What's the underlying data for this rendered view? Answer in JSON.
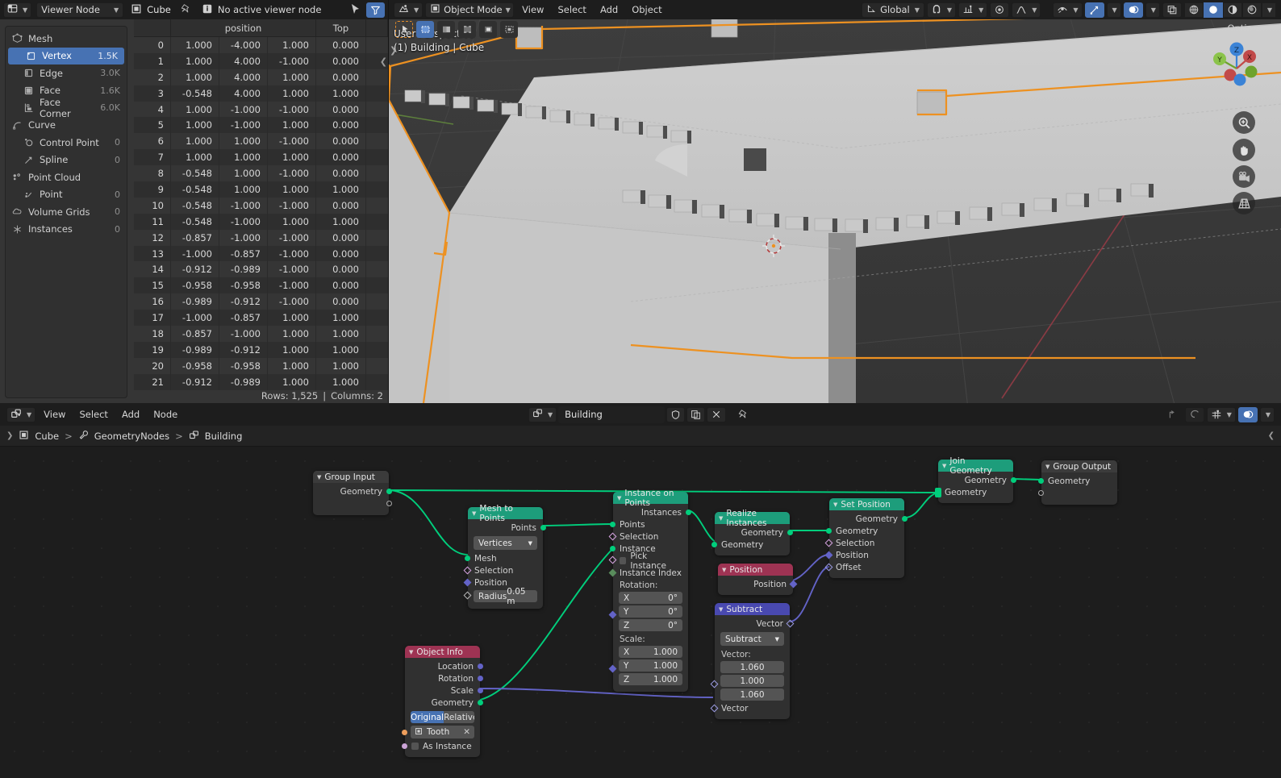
{
  "spreadsheet": {
    "editor_type_icon": "spreadsheet-editor-icon",
    "viewer_mode": "Viewer Node",
    "object_name": "Cube",
    "pin_icon": "pin-icon",
    "info_icon": "info-icon",
    "info_text": "No active viewer node",
    "cursor_filter_icon": "cursor-icon",
    "filter_icon": "filter-icon",
    "dataset": [
      {
        "label": "Mesh",
        "icon": "mesh-data-icon",
        "count": "",
        "level": 0,
        "selected": false
      },
      {
        "label": "Vertex",
        "icon": "vertex-icon",
        "count": "1.5K",
        "level": 1,
        "selected": true
      },
      {
        "label": "Edge",
        "icon": "edge-icon",
        "count": "3.0K",
        "level": 1,
        "selected": false
      },
      {
        "label": "Face",
        "icon": "face-icon",
        "count": "1.6K",
        "level": 1,
        "selected": false
      },
      {
        "label": "Face Corner",
        "icon": "face-corner-icon",
        "count": "6.0K",
        "level": 1,
        "selected": false
      },
      {
        "label": "Curve",
        "icon": "curve-data-icon",
        "count": "",
        "level": 0,
        "selected": false
      },
      {
        "label": "Control Point",
        "icon": "control-point-icon",
        "count": "0",
        "level": 1,
        "selected": false
      },
      {
        "label": "Spline",
        "icon": "spline-icon",
        "count": "0",
        "level": 1,
        "selected": false
      },
      {
        "label": "Point Cloud",
        "icon": "point-cloud-icon",
        "count": "",
        "level": 0,
        "selected": false
      },
      {
        "label": "Point",
        "icon": "point-icon",
        "count": "0",
        "level": 1,
        "selected": false
      },
      {
        "label": "Volume Grids",
        "icon": "volume-icon",
        "count": "0",
        "level": 0,
        "selected": false
      },
      {
        "label": "Instances",
        "icon": "instances-icon",
        "count": "0",
        "level": 0,
        "selected": false
      }
    ],
    "columns": {
      "index": "",
      "position": "position",
      "top": "Top"
    },
    "rows": [
      {
        "i": "0",
        "x": "1.000",
        "y": "-4.000",
        "z": "1.000",
        "top": "0.000"
      },
      {
        "i": "1",
        "x": "1.000",
        "y": "4.000",
        "z": "-1.000",
        "top": "0.000"
      },
      {
        "i": "2",
        "x": "1.000",
        "y": "4.000",
        "z": "1.000",
        "top": "0.000"
      },
      {
        "i": "3",
        "x": "-0.548",
        "y": "4.000",
        "z": "1.000",
        "top": "1.000"
      },
      {
        "i": "4",
        "x": "1.000",
        "y": "-1.000",
        "z": "-1.000",
        "top": "0.000"
      },
      {
        "i": "5",
        "x": "1.000",
        "y": "-1.000",
        "z": "1.000",
        "top": "0.000"
      },
      {
        "i": "6",
        "x": "1.000",
        "y": "1.000",
        "z": "-1.000",
        "top": "0.000"
      },
      {
        "i": "7",
        "x": "1.000",
        "y": "1.000",
        "z": "1.000",
        "top": "0.000"
      },
      {
        "i": "8",
        "x": "-0.548",
        "y": "1.000",
        "z": "-1.000",
        "top": "0.000"
      },
      {
        "i": "9",
        "x": "-0.548",
        "y": "1.000",
        "z": "1.000",
        "top": "1.000"
      },
      {
        "i": "10",
        "x": "-0.548",
        "y": "-1.000",
        "z": "-1.000",
        "top": "0.000"
      },
      {
        "i": "11",
        "x": "-0.548",
        "y": "-1.000",
        "z": "1.000",
        "top": "1.000"
      },
      {
        "i": "12",
        "x": "-0.857",
        "y": "-1.000",
        "z": "-1.000",
        "top": "0.000"
      },
      {
        "i": "13",
        "x": "-1.000",
        "y": "-0.857",
        "z": "-1.000",
        "top": "0.000"
      },
      {
        "i": "14",
        "x": "-0.912",
        "y": "-0.989",
        "z": "-1.000",
        "top": "0.000"
      },
      {
        "i": "15",
        "x": "-0.958",
        "y": "-0.958",
        "z": "-1.000",
        "top": "0.000"
      },
      {
        "i": "16",
        "x": "-0.989",
        "y": "-0.912",
        "z": "-1.000",
        "top": "0.000"
      },
      {
        "i": "17",
        "x": "-1.000",
        "y": "-0.857",
        "z": "1.000",
        "top": "1.000"
      },
      {
        "i": "18",
        "x": "-0.857",
        "y": "-1.000",
        "z": "1.000",
        "top": "1.000"
      },
      {
        "i": "19",
        "x": "-0.989",
        "y": "-0.912",
        "z": "1.000",
        "top": "1.000"
      },
      {
        "i": "20",
        "x": "-0.958",
        "y": "-0.958",
        "z": "1.000",
        "top": "1.000"
      },
      {
        "i": "21",
        "x": "-0.912",
        "y": "-0.989",
        "z": "1.000",
        "top": "1.000"
      }
    ],
    "status_rows": "Rows: 1,525",
    "status_sep": "|",
    "status_columns": "Columns: 2"
  },
  "viewport": {
    "editor_icon": "editor-type-icon",
    "mode": "Object Mode",
    "menus": [
      "View",
      "Select",
      "Add",
      "Object"
    ],
    "transform_orientation": "Global",
    "snap_icon": "snap-magnet-icon",
    "proportional_icon": "proportional-editing-icon",
    "tools": [
      "tweak-tool-icon",
      "select-box-icon",
      "select-circle-icon",
      "select-lasso-icon",
      "select-extend-icon",
      "select-subtract-icon"
    ],
    "overlay_icons": [
      "visibility-icon",
      "gizmo-icon",
      "overlays-icon",
      "xray-icon"
    ],
    "shading_modes": [
      "wireframe-shading-icon",
      "solid-shading-icon",
      "material-preview-icon",
      "rendered-shading-icon"
    ],
    "options_label": "Options",
    "perspective_label": "User Perspective",
    "scene_label": "(1) Building | Cube",
    "gizmo_axes": {
      "x": "X",
      "y": "Y",
      "z": "Z"
    },
    "side_buttons": [
      "zoom-icon",
      "pan-hand-icon",
      "camera-view-icon",
      "ortho-persp-icon"
    ],
    "selection_color": "#ed9121",
    "object_color": "#c6c6c6",
    "background_color": "#393939"
  },
  "node_editor": {
    "editor_icon": "geometry-nodes-editor-icon",
    "menus": [
      "View",
      "Select",
      "Add",
      "Node"
    ],
    "modifier_icon": "geometry-nodes-icon",
    "tree_name": "Building",
    "shield_icon": "fake-user-icon",
    "copy_icon": "new-copy-icon",
    "close_icon": "unlink-icon",
    "pin_icon": "pin-icon",
    "snap_up_icon": "parent-up-icon",
    "overlay_icon": "node-overlay-icon",
    "snap_icon": "snap-grid-icon",
    "gizmo_icon": "node-gizmo-icon",
    "breadcrumb": [
      {
        "label": "Cube",
        "icon": "object-icon"
      },
      {
        "label": "GeometryNodes",
        "icon": "modifier-wrench-icon"
      },
      {
        "label": "Building",
        "icon": "geometry-nodes-icon"
      }
    ],
    "breadcrumb_sep": ">",
    "nodes": {
      "group_input": {
        "title": "Group Input",
        "color": "#3b3b3b",
        "outputs": [
          "Geometry",
          ""
        ]
      },
      "mesh_to_points": {
        "title": "Mesh to Points",
        "color": "#1d9d7b",
        "outputs": [
          "Points"
        ],
        "mode": "Vertices",
        "inputs": [
          "Mesh",
          "Selection",
          "Position"
        ],
        "radius_label": "Radius",
        "radius_value": "0.05 m"
      },
      "instance_on_points": {
        "title": "Instance on Points",
        "color": "#1d9d7b",
        "outputs": [
          "Instances"
        ],
        "inputs": [
          "Points",
          "Selection",
          "Instance",
          "Pick Instance",
          "Instance Index"
        ],
        "rotation_label": "Rotation:",
        "rotation": [
          {
            "axis": "X",
            "value": "0°"
          },
          {
            "axis": "Y",
            "value": "0°"
          },
          {
            "axis": "Z",
            "value": "0°"
          }
        ],
        "scale_label": "Scale:",
        "scale": [
          {
            "axis": "X",
            "value": "1.000"
          },
          {
            "axis": "Y",
            "value": "1.000"
          },
          {
            "axis": "Z",
            "value": "1.000"
          }
        ]
      },
      "realize_instances": {
        "title": "Realize Instances",
        "color": "#1d9d7b",
        "outputs": [
          "Geometry"
        ],
        "inputs": [
          "Geometry"
        ]
      },
      "position": {
        "title": "Position",
        "color": "#9e3353",
        "outputs": [
          "Position"
        ]
      },
      "subtract": {
        "title": "Subtract",
        "color": "#4949b0",
        "outputs": [
          "Vector"
        ],
        "operation": "Subtract",
        "vector_label": "Vector:",
        "vector_values": [
          "1.060",
          "1.000",
          "1.060"
        ],
        "input_label": "Vector"
      },
      "set_position": {
        "title": "Set Position",
        "color": "#1d9d7b",
        "outputs": [
          "Geometry"
        ],
        "inputs": [
          "Geometry",
          "Selection",
          "Position",
          "Offset"
        ]
      },
      "join_geometry": {
        "title": "Join Geometry",
        "color": "#1d9d7b",
        "outputs": [
          "Geometry"
        ],
        "inputs": [
          "Geometry"
        ]
      },
      "group_output": {
        "title": "Group Output",
        "color": "#3b3b3b",
        "inputs": [
          "Geometry",
          ""
        ]
      },
      "object_info": {
        "title": "Object Info",
        "color": "#9e3353",
        "outputs": [
          "Location",
          "Rotation",
          "Scale",
          "Geometry"
        ],
        "toggle": [
          "Original",
          "Relative"
        ],
        "toggle_active": "Original",
        "object_field": "Tooth",
        "object_clear_icon": "x-icon",
        "as_instance_label": "As Instance"
      }
    }
  }
}
